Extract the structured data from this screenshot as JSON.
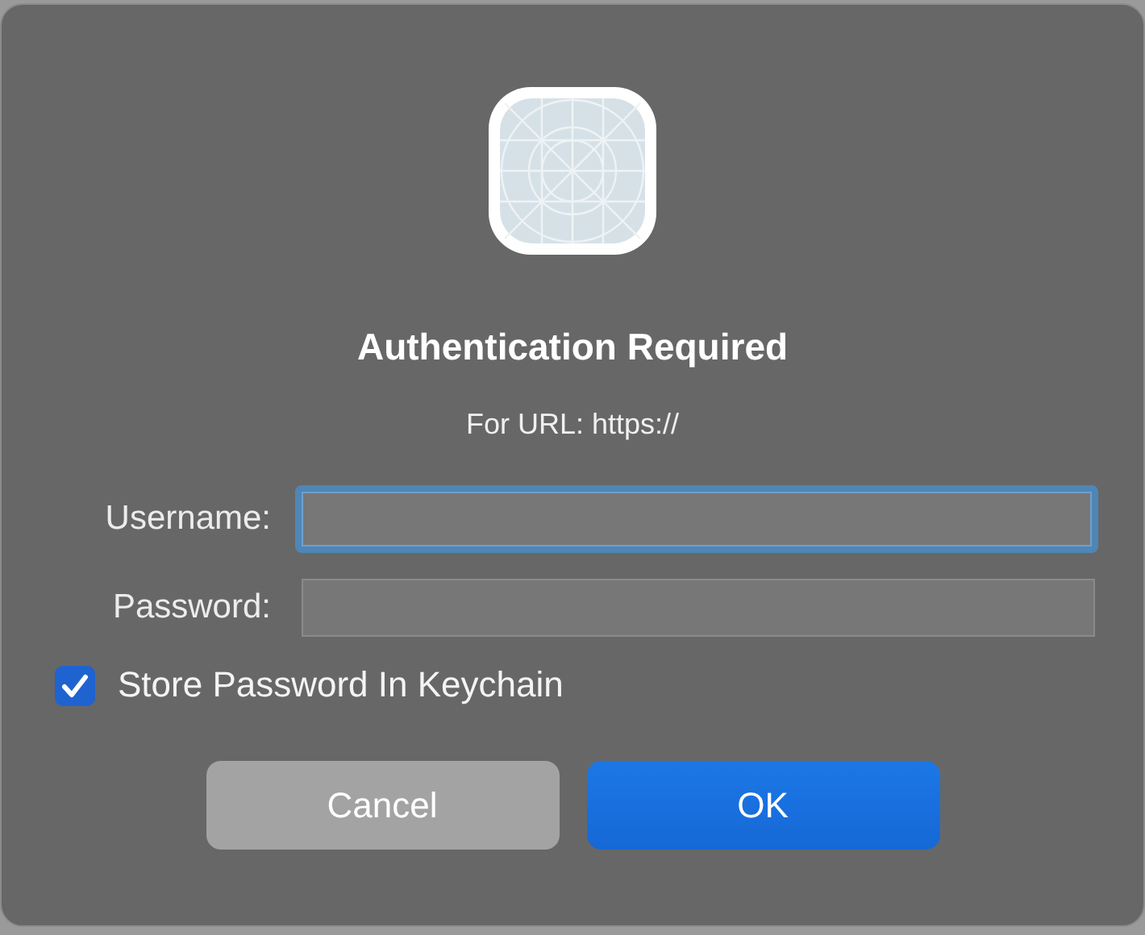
{
  "dialog": {
    "title": "Authentication Required",
    "message": "For URL: https://"
  },
  "fields": [
    {
      "label": "Username:",
      "focused": true
    },
    {
      "label": "Password:",
      "focused": false
    }
  ],
  "checkbox": {
    "label": "Store Password In Keychain",
    "checked": true
  },
  "buttons": [
    {
      "label": "Cancel",
      "kind": "secondary"
    },
    {
      "label": "OK",
      "kind": "primary"
    }
  ]
}
